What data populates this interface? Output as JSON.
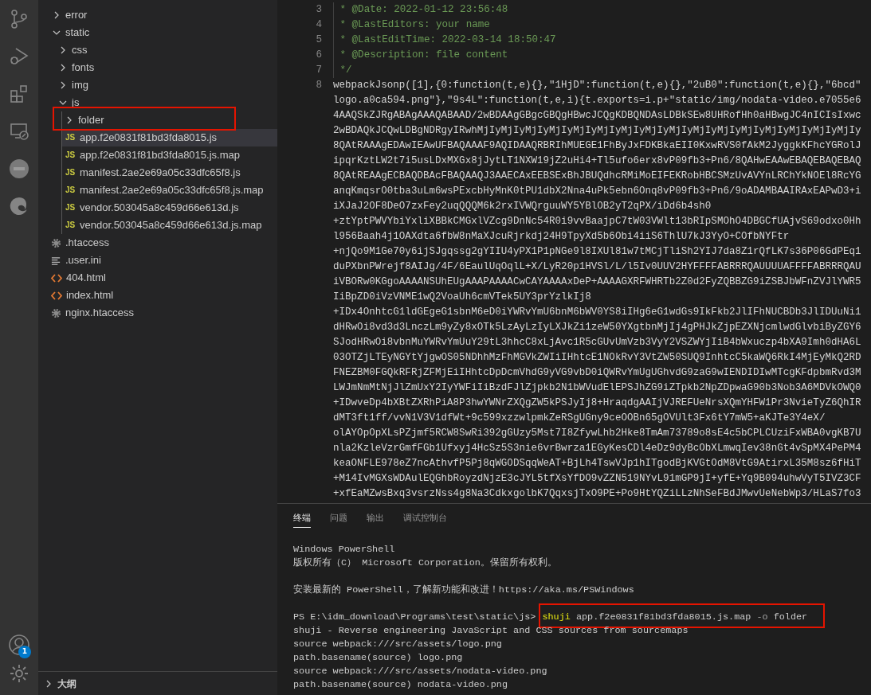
{
  "activity_bar": {
    "badge": "1"
  },
  "explorer": {
    "tree": [
      {
        "label": "error",
        "kind": "folder",
        "expanded": false,
        "selected": false,
        "highlighted": false
      },
      {
        "label": "static",
        "kind": "folder",
        "expanded": true,
        "selected": false,
        "highlighted": false,
        "children": [
          {
            "label": "css",
            "kind": "folder",
            "expanded": false,
            "selected": false,
            "highlighted": false
          },
          {
            "label": "fonts",
            "kind": "folder",
            "expanded": false,
            "selected": false,
            "highlighted": false
          },
          {
            "label": "img",
            "kind": "folder",
            "expanded": false,
            "selected": false,
            "highlighted": false
          },
          {
            "label": "js",
            "kind": "folder",
            "expanded": true,
            "selected": false,
            "highlighted": false,
            "children": [
              {
                "label": "folder",
                "kind": "folder",
                "expanded": false,
                "selected": false,
                "highlighted": true
              },
              {
                "label": "app.f2e0831f81bd3fda8015.js",
                "kind": "js",
                "icon_label": "JS",
                "selected": true,
                "highlighted": false
              },
              {
                "label": "app.f2e0831f81bd3fda8015.js.map",
                "kind": "js",
                "icon_label": "JS",
                "selected": false,
                "highlighted": false
              },
              {
                "label": "manifest.2ae2e69a05c33dfc65f8.js",
                "kind": "js",
                "icon_label": "JS",
                "selected": false,
                "highlighted": false
              },
              {
                "label": "manifest.2ae2e69a05c33dfc65f8.js.map",
                "kind": "js",
                "icon_label": "JS",
                "selected": false,
                "highlighted": false
              },
              {
                "label": "vendor.503045a8c459d66e613d.js",
                "kind": "js",
                "icon_label": "JS",
                "selected": false,
                "highlighted": false
              },
              {
                "label": "vendor.503045a8c459d66e613d.js.map",
                "kind": "js",
                "icon_label": "JS",
                "selected": false,
                "highlighted": false
              }
            ]
          }
        ]
      },
      {
        "label": ".htaccess",
        "kind": "gear",
        "selected": false,
        "highlighted": false
      },
      {
        "label": ".user.ini",
        "kind": "lines",
        "selected": false,
        "highlighted": false
      },
      {
        "label": "404.html",
        "kind": "html",
        "selected": false,
        "highlighted": false
      },
      {
        "label": "index.html",
        "kind": "html",
        "selected": false,
        "highlighted": false
      },
      {
        "label": "nginx.htaccess",
        "kind": "gear",
        "selected": false,
        "highlighted": false
      }
    ],
    "outline": {
      "label": "大纲",
      "expanded": false
    }
  },
  "editor": {
    "lines": [
      {
        "number": "3",
        "kind": "comment",
        "text": " * @Date: 2022-01-12 23:56:48"
      },
      {
        "number": "4",
        "kind": "comment",
        "text": " * @LastEditors: your name"
      },
      {
        "number": "5",
        "kind": "comment",
        "text": " * @LastEditTime: 2022-03-14 18:50:47"
      },
      {
        "number": "6",
        "kind": "comment",
        "text": " * @Description: file content"
      },
      {
        "number": "7",
        "kind": "comment",
        "text": " */"
      },
      {
        "number": "8",
        "kind": "code",
        "text": "webpackJsonp([1],{0:function(t,e){},\"1HjD\":function(t,e){},\"2uB0\":function(t,e){},\"6bcd\""
      },
      {
        "kind": "code",
        "text": "logo.a0ca594.png\"},\"9s4L\":function(t,e,i){t.exports=i.p+\"static/img/nodata-video.e7055e6"
      },
      {
        "kind": "code",
        "text": "4AAQSkZJRgABAgAAAQABAAD/2wBDAAgGBgcGBQgHBwcJCQgKDBQNDAsLDBkSEw8UHRofHh0aHBwgJC4nICIsIxwc"
      },
      {
        "kind": "code",
        "text": "2wBDAQkJCQwLDBgNDRgyIRwhMjIyMjIyMjIyMjIyMjIyMjIyMjIyMjIyMjIyMjIyMjIyMjIyMjIyMjIyMjIyMjIy"
      },
      {
        "kind": "code",
        "text": "8QAtRAAAgEDAwIEAwUFBAQAAAF9AQIDAAQRBRIhMUEGE1FhByJxFDKBkaEII0KxwRVS0fAkM2JyggkKFhcYGRolJ"
      },
      {
        "kind": "code",
        "text": "ipqrKztLW2t7i5usLDxMXGx8jJytLT1NXW19jZ2uHi4+Tl5ufo6erx8vP09fb3+Pn6/8QAHwEAAwEBAQEBAQEBAQ"
      },
      {
        "kind": "code",
        "text": "8QAtREAAgECBAQDBAcFBAQAAQJ3AAECAxEEBSExBhJBUQdhcRMiMoEIFEKRobHBCSMzUvAVYnLRChYkNOEl8RcYG"
      },
      {
        "kind": "code",
        "text": "anqKmqsrO0tba3uLm6wsPExcbHyMnK0tPU1dbX2Nna4uPk5ebn6Onq8vP09fb3+Pn6/9oADAMBAAIRAxEAPwD3+i"
      },
      {
        "kind": "code",
        "text": "iXJaJ2OF8DeO7zxFey2uqQQQM6k2rxIVWQrguuWY5YBlOB2yT2qPX/iDd6b4sh0"
      },
      {
        "kind": "code",
        "text": "+ztYptPWVYbiYxliXBBkCMGxlVZcg9DnNc54R0i9vvBaajpC7tW03VWlt13bRIpSMOhO4DBGCfUAjvS69odxo0Hh"
      },
      {
        "kind": "code",
        "text": "l956Baah4j1OAXdta6fbW8nMaXJcuRjrkdj24H9TpyXd5b6Obi4iiS6ThlU7kJ3YyO+COfbNYFtr"
      },
      {
        "kind": "code",
        "text": "+njQo9M1Ge70y6ijSJgqssg2gYIIU4yPX1P1pNGe9l8IXUl81w7tMCjTliSh2YIJ7da8Z1rQfLK7s36P06GdPEq1"
      },
      {
        "kind": "code",
        "text": "duPXbnPWrejf8AIJg/4F/6EaulUqOqlL+X/LyR20p1HVSl/L/l5Iv0UUV2HYFFFFABRRRQAUUUUAFFFFABRRRQAU"
      },
      {
        "kind": "code",
        "text": "iVBORw0KGgoAAAANSUhEUgAAAPAAAACwCAYAAAAxDeP+AAAAGXRFWHRTb2Z0d2FyZQBBZG9iZSBJbWFnZVJlYWR5"
      },
      {
        "kind": "code",
        "text": "IiBpZD0iVzVNME1wQ2VoaUh6cmVTek5UY3prYzlkIj8"
      },
      {
        "kind": "code",
        "text": "+IDx4OnhtcG1ldGEgeG1sbnM6eD0iYWRvYmU6bnM6bWV0YS8iIHg6eG1wdGs9IkFkb2JlIFhNUCBDb3JlIDUuNi1"
      },
      {
        "kind": "code",
        "text": "dHRwOi8vd3d3LnczLm9yZy8xOTk5LzAyLzIyLXJkZi1zeW50YXgtbnMjIj4gPHJkZjpEZXNjcmlwdGlvbiByZGY6"
      },
      {
        "kind": "code",
        "text": "SJodHRwOi8vbnMuYWRvYmUuY29tL3hhcC8xLjAvc1R5cGUvUmVzb3VyY2VSZWYjIiB4bWxuczp4bXA9Imh0dHA6L"
      },
      {
        "kind": "code",
        "text": "03OTZjLTEyNGYtYjgwOS05NDhhMzFhMGVkZWIiIHhtcE1NOkRvY3VtZW50SUQ9InhtcC5kaWQ6RkI4MjEyMkQ2RD"
      },
      {
        "kind": "code",
        "text": "FNEZBM0FGQkRFRjZFMjEiIHhtcDpDcmVhdG9yVG9vbD0iQWRvYmUgUGhvdG9zaG9wIENDIDIwMTcgKFdpbmRvd3M"
      },
      {
        "kind": "code",
        "text": "LWJmNmMtNjJlZmUxY2IyYWFiIiBzdFJlZjpkb2N1bWVudElEPSJhZG9iZTpkb2NpZDpwaG90b3Nob3A6MDVkOWQ0"
      },
      {
        "kind": "code",
        "text": "+IDwveDp4bXBtZXRhPiA8P3hwYWNrZXQgZW5kPSJyIj8+HraqdgAAIjVJREFUeNrsXQmYHFW1Pr3NvieTyZ6QhIR"
      },
      {
        "kind": "code",
        "text": "dMT3ft1ff/vvN1V3V1dfWt+9c599xzzwlpmkZeRSgUGny9ceOOBn65gOVUlt3Fx6tY7mW5+aKJTe3Y4eX/"
      },
      {
        "kind": "code",
        "text": "olAYOpOpXLsPZjmf5RCW8SwRi392gGUzy5Mst7I8ZfywLhb2Hke8TmAm73789o8sE4c5bCPLCUziFxWBA0vgKB7U"
      },
      {
        "kind": "code",
        "text": "nla2KzleVzrGmfFGb1Ufxyj4HcSz5S3nie6vrBwrza1EGyKesCDl4eDz9dyBcObXLmwqIev38nGt4vSpMX4PePM4"
      },
      {
        "kind": "code",
        "text": "keaONFLE978eZ7ncAthvfP5Pj8qWGODSqqWeAT+BjLh4TswVJp1hITgodBjKVGtOdM8VtG9AtirxL35M8sz6fHiT"
      },
      {
        "kind": "code",
        "text": "+M14IvMGXsWDAulEQGhbRoyzdNjzE3cJYL5tfXsYfDO9vZZN519NYvL91mGP9jI+yfE+Yq9B094uhwVyT5IVZ3CF"
      },
      {
        "kind": "code",
        "text": "+xfEaMZwsBxq3vsrzNss4g8Na3CdkxgolbK7QqxsjTxO9PE+Po9HtYQZiLLzNhSeFBdJMwvUeNebWp3/HLaS7fo3"
      }
    ]
  },
  "panel": {
    "tabs": [
      {
        "label": "终端",
        "selected": true
      },
      {
        "label": "问题",
        "selected": false
      },
      {
        "label": "输出",
        "selected": false
      },
      {
        "label": "调试控制台",
        "selected": false
      }
    ],
    "terminal": [
      [
        {
          "kind": "text",
          "text": "Windows PowerShell"
        },
        {
          "kind": "text",
          "text": "版权所有（C） Microsoft Corporation。保留所有权利。"
        }
      ],
      [
        {
          "kind": "text",
          "text": "安装最新的 PowerShell，了解新功能和改进！https://aka.ms/PSWindows"
        }
      ],
      [
        {
          "kind": "prompt",
          "prompt": "PS E:\\idm_download\\Programs\\test\\static\\js>",
          "command": "shuji",
          "args": "app.f2e0831f81bd3fda8015.js.map",
          "flag": "-o",
          "value": "folder",
          "highlighted": true
        },
        {
          "kind": "text",
          "text": "shuji - Reverse engineering JavaScript and CSS sources from sourcemaps"
        },
        {
          "kind": "text",
          "text": "source webpack:///src/assets/logo.png"
        },
        {
          "kind": "text",
          "text": "path.basename(source) logo.png"
        },
        {
          "kind": "text",
          "text": "source webpack:///src/assets/nodata-video.png"
        },
        {
          "kind": "text",
          "text": "path.basename(source) nodata-video.png"
        }
      ]
    ]
  }
}
